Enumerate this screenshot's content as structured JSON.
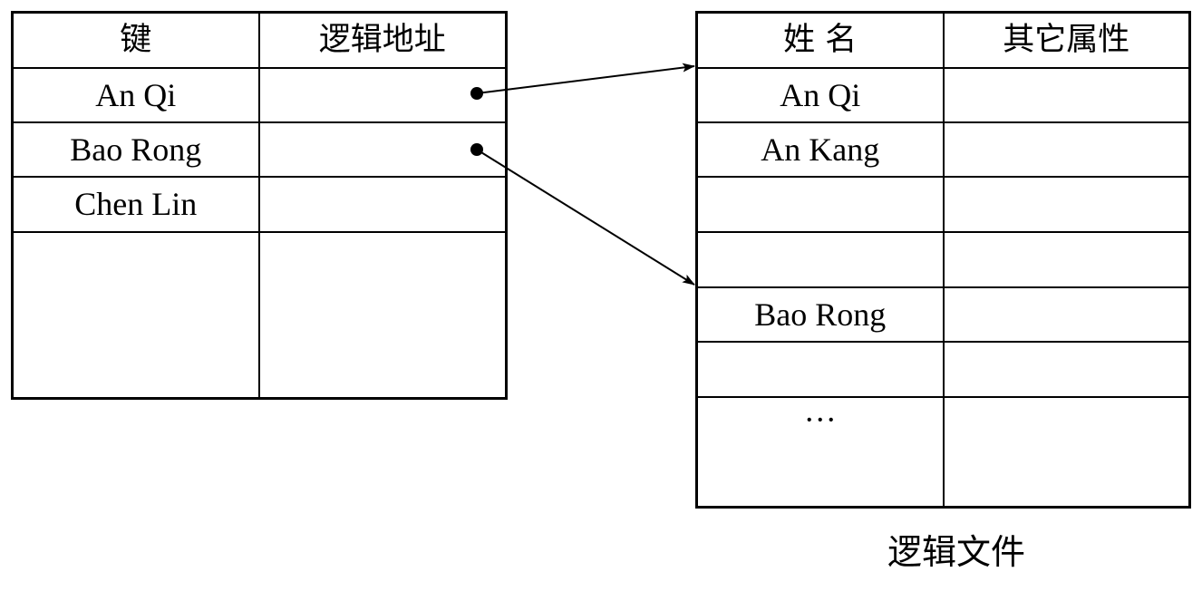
{
  "index_table": {
    "headers": [
      "键",
      "逻辑地址"
    ],
    "keys": [
      "An Qi",
      "Bao Rong",
      "Chen Lin",
      ""
    ]
  },
  "file_table": {
    "headers": [
      "姓 名",
      "其它属性"
    ],
    "names": [
      "An Qi",
      "An Kang",
      "",
      "",
      "Bao Rong",
      "",
      "···"
    ]
  },
  "caption": "逻辑文件"
}
